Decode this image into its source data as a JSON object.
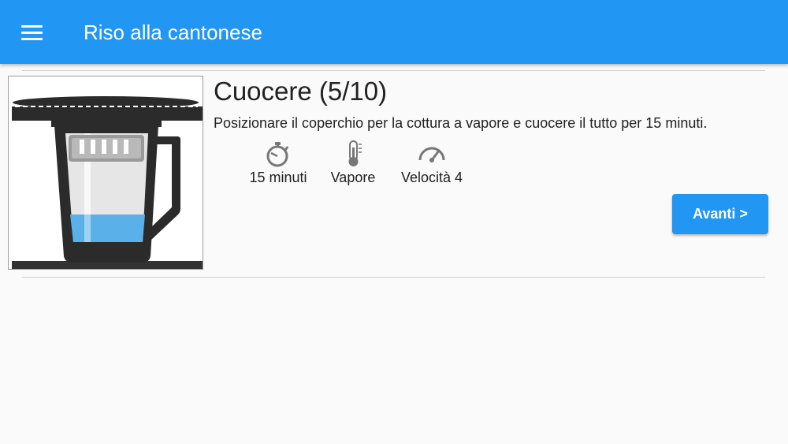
{
  "appbar": {
    "title": "Riso alla cantonese",
    "menu_icon": "hamburger-menu-icon"
  },
  "step": {
    "title": "Cuocere (5/10)",
    "description": "Posizionare il coperchio per la cottura a vapore e cuocere il tutto per 15 minuti.",
    "params": [
      {
        "icon": "timer-icon",
        "label": "15 minuti"
      },
      {
        "icon": "thermometer-icon",
        "label": "Vapore"
      },
      {
        "icon": "speedometer-icon",
        "label": "Velocità 4"
      }
    ],
    "next_label": "Avanti >"
  },
  "colors": {
    "primary": "#2196f3",
    "water": "#5ab0e8",
    "jug": "#333333"
  }
}
